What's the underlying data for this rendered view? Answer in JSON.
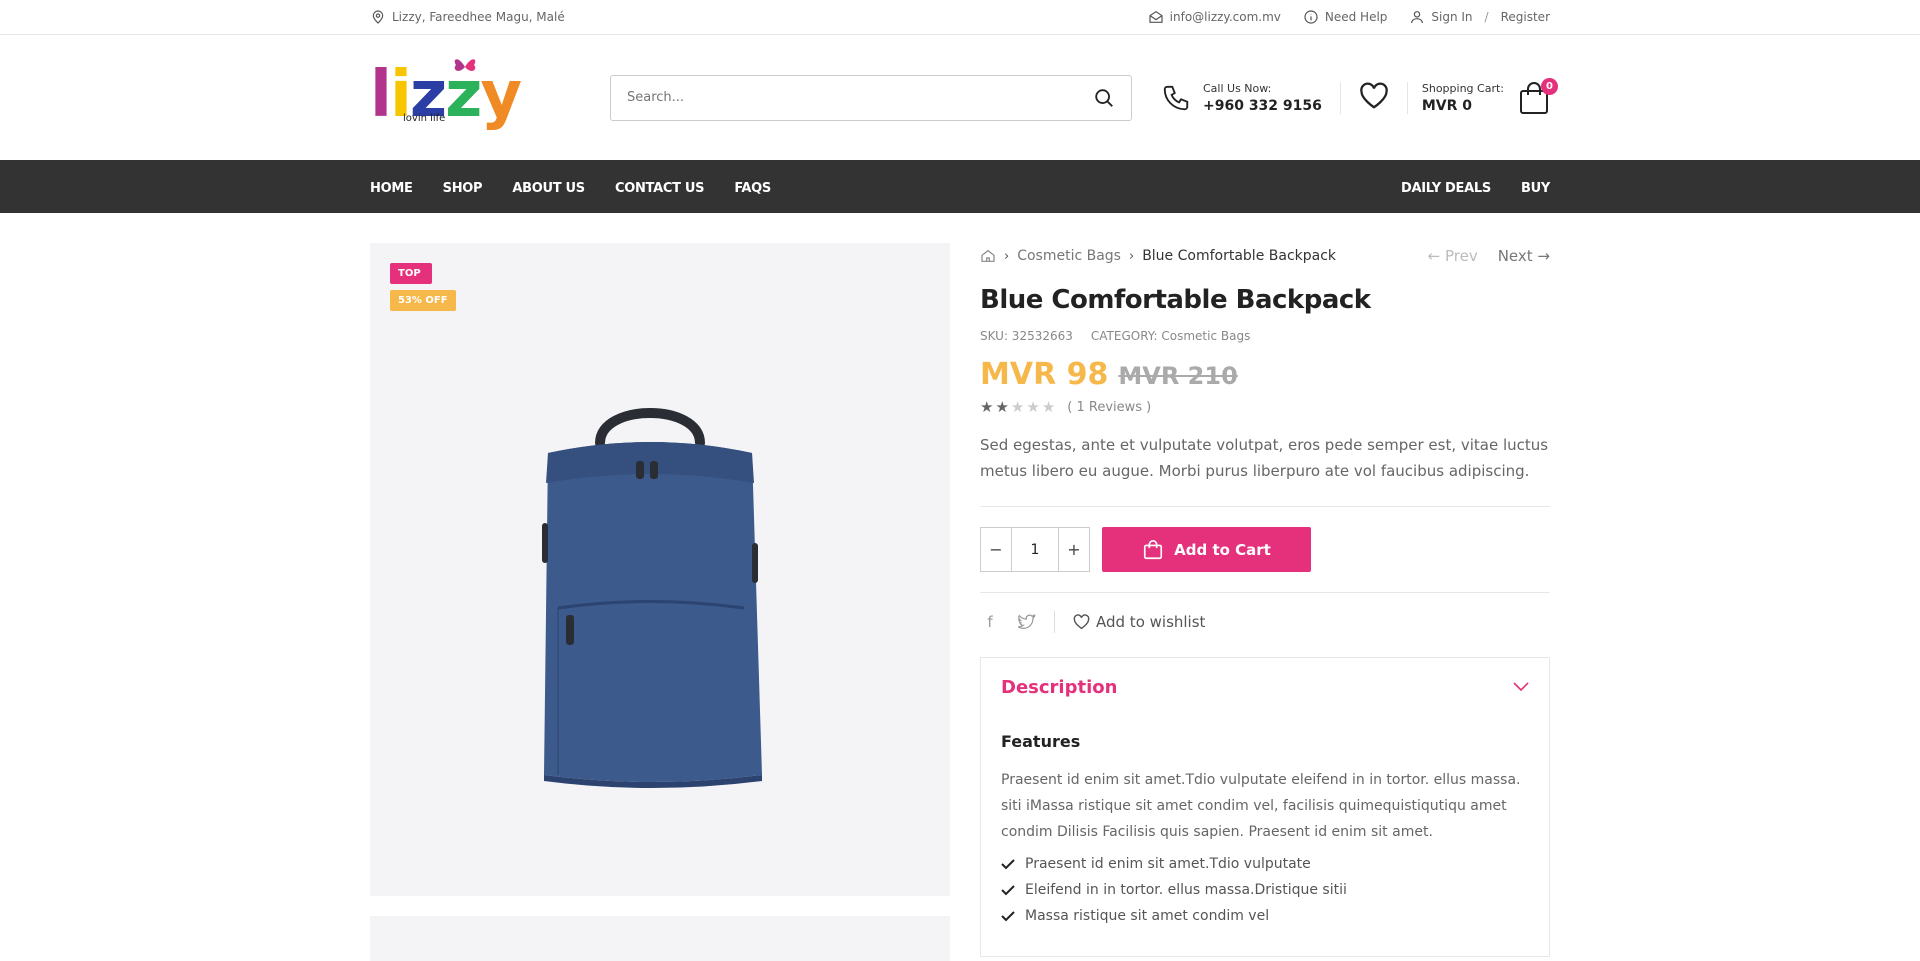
{
  "topbar": {
    "address": "Lizzy, Fareedhee Magu, Malé",
    "email": "info@lizzy.com.mv",
    "help": "Need Help",
    "sign_in": "Sign In",
    "separator": "/",
    "register": "Register"
  },
  "header": {
    "logo_letters": [
      "l",
      "i",
      "z",
      "z",
      "y"
    ],
    "logo_tagline": "lovin life",
    "search_placeholder": "Search...",
    "call_label": "Call Us Now:",
    "call_number": "+960 332 9156",
    "cart_label": "Shopping Cart:",
    "cart_total": "MVR 0",
    "cart_count": "0"
  },
  "nav": {
    "left": [
      "HOME",
      "SHOP",
      "ABOUT US",
      "CONTACT US",
      "FAQS"
    ],
    "right": [
      "DAILY DEALS",
      "BUY"
    ]
  },
  "product": {
    "labels": {
      "top": "TOP",
      "discount": "53% OFF"
    },
    "breadcrumb": {
      "category": "Cosmetic Bags",
      "current": "Blue Comfortable Backpack"
    },
    "prev": "Prev",
    "next": "Next",
    "title": "Blue Comfortable Backpack",
    "sku": "SKU: 32532663",
    "category": "CATEGORY: Cosmetic Bags",
    "price_new": "MVR 98",
    "price_old": "MVR 210",
    "rating": 2,
    "rating_max": 5,
    "reviews": "( 1 Reviews )",
    "description": "Sed egestas, ante et vulputate volutpat, eros pede semper est, vitae luctus metus libero eu augue. Morbi purus liberpuro ate vol faucibus adipiscing.",
    "qty": "1",
    "qty_minus": "−",
    "qty_plus": "+",
    "add_to_cart": "Add to Cart",
    "add_to_wishlist": "Add to wishlist",
    "accordion": {
      "title": "Description",
      "features_title": "Features",
      "features_text": "Praesent id enim sit amet.Tdio vulputate eleifend in in tortor. ellus massa. siti iMassa ristique sit amet condim vel, facilisis quimequistiqutiqu amet condim Dilisis Facilisis quis sapien. Praesent id enim sit amet.",
      "features_list": [
        "Praesent id enim sit amet.Tdio vulputate",
        "Eleifend in in tortor. ellus massa.Dristique sitii",
        "Massa ristique sit amet condim vel"
      ]
    }
  },
  "colors": {
    "accent": "#e5307b",
    "price": "#f6b84b",
    "nav_bg": "#333333"
  },
  "icons": {
    "address": "map-pin-icon",
    "email": "envelope-icon",
    "help": "info-icon",
    "user": "user-icon",
    "search": "search-icon",
    "phone": "phone-icon",
    "wishlist": "heart-icon",
    "cart": "shopping-bag-icon",
    "home": "home-icon",
    "facebook": "facebook-icon",
    "twitter": "twitter-icon",
    "expand": "chevron-down-icon",
    "check": "check-icon"
  }
}
